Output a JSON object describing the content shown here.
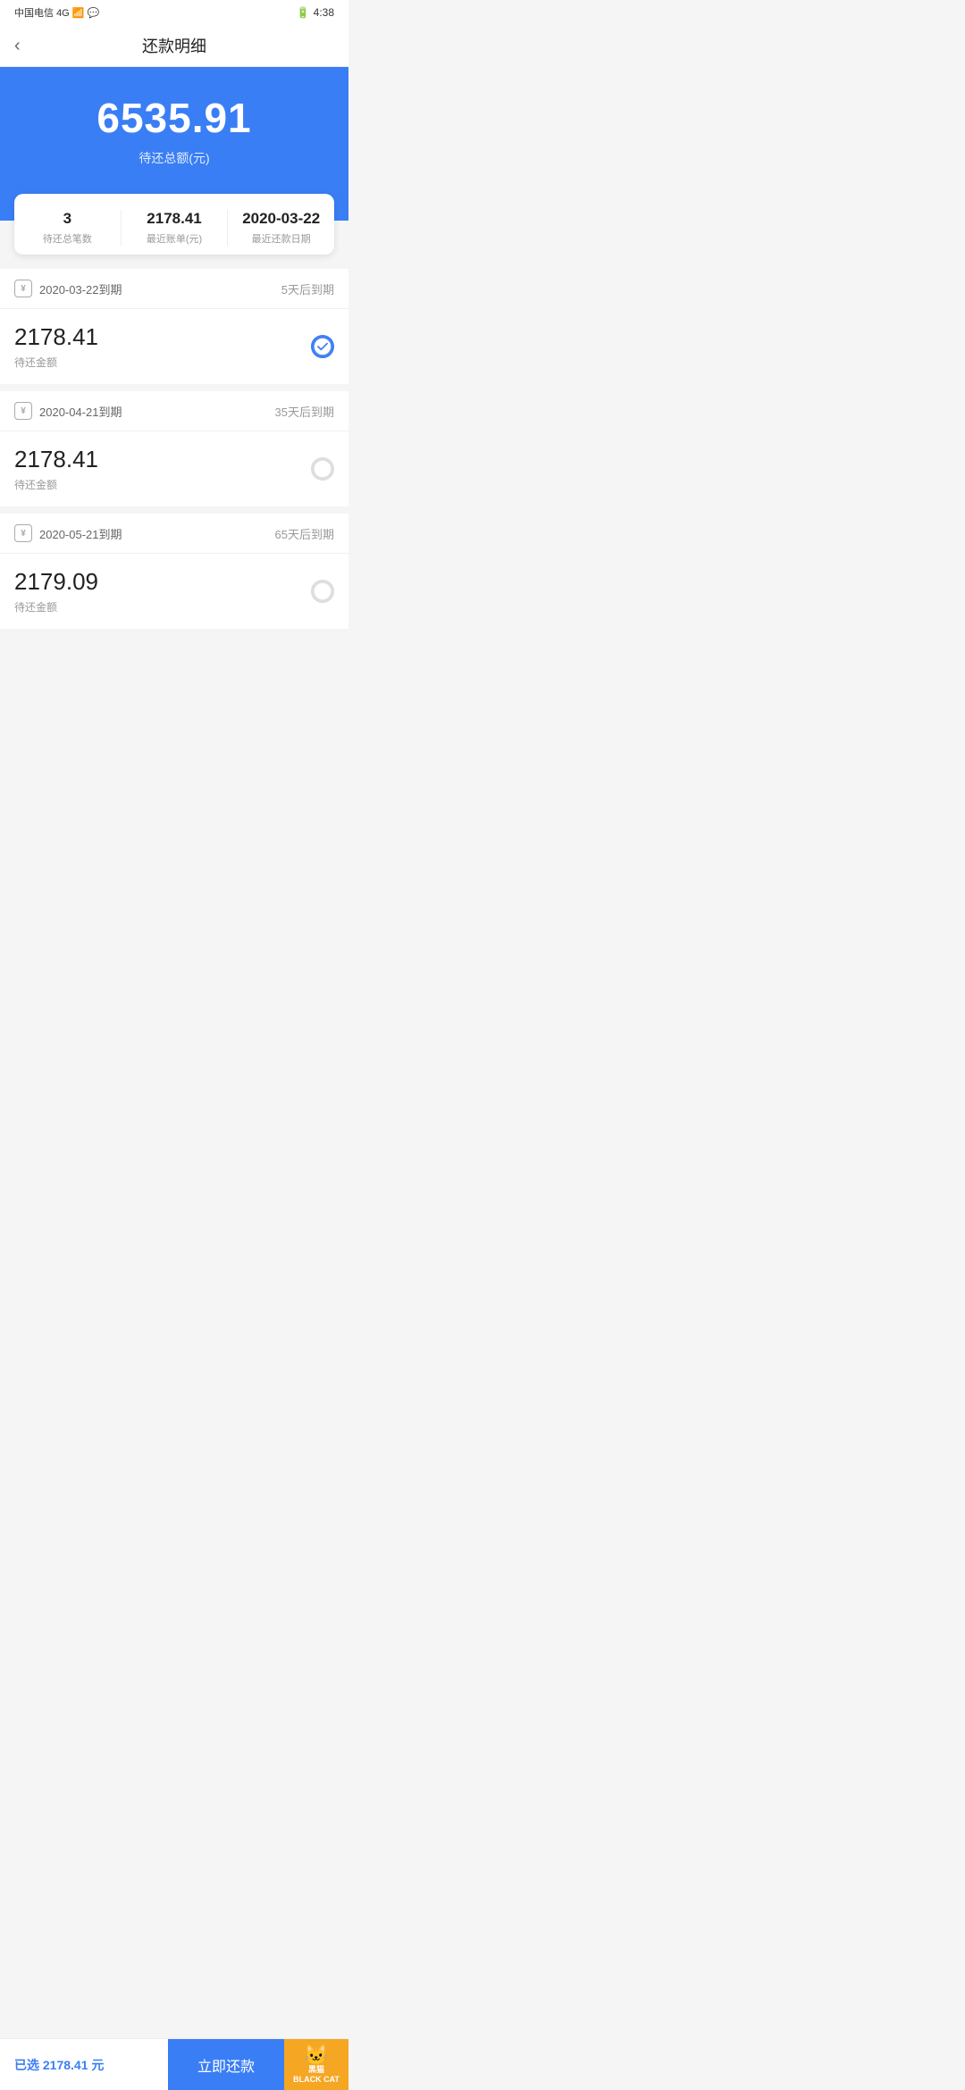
{
  "statusBar": {
    "carrier": "中国电信",
    "signal": "4G",
    "time": "4:38"
  },
  "header": {
    "backLabel": "‹",
    "title": "还款明细"
  },
  "hero": {
    "amount": "6535.91",
    "label": "待还总额(元)"
  },
  "summary": {
    "items": [
      {
        "value": "3",
        "desc": "待还总笔数"
      },
      {
        "value": "2178.41",
        "desc": "最近账单(元)"
      },
      {
        "value": "2020-03-22",
        "desc": "最近还款日期"
      }
    ]
  },
  "payments": [
    {
      "date": "2020-03-22到期",
      "dueDays": "5天后到期",
      "amount": "2178.41",
      "amountLabel": "待还金额",
      "checked": true
    },
    {
      "date": "2020-04-21到期",
      "dueDays": "35天后到期",
      "amount": "2178.41",
      "amountLabel": "待还金额",
      "checked": false
    },
    {
      "date": "2020-05-21到期",
      "dueDays": "65天后到期",
      "amount": "2179.09",
      "amountLabel": "待还金额",
      "checked": false
    }
  ],
  "bottomBar": {
    "selectedPrefix": "已选",
    "selectedAmount": "2178.41",
    "selectedSuffix": "元",
    "payButtonLabel": "立即还款",
    "blackcat": {
      "catEmoji": "🐱",
      "text": "黑猫\nBLACK CAT"
    }
  }
}
